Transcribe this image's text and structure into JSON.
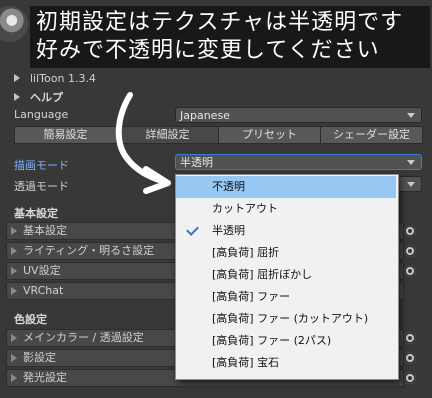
{
  "caption": {
    "line1": "初期設定はテクスチャは半透明です",
    "line2": "好みで不透明に変更してください"
  },
  "header": {
    "version": "lilToon 1.3.4",
    "help": "ヘルプ"
  },
  "language": {
    "label": "Language",
    "value": "Japanese"
  },
  "tabs": [
    {
      "label": "簡易設定"
    },
    {
      "label": "詳細設定"
    },
    {
      "label": "プリセット"
    },
    {
      "label": "シェーダー設定"
    }
  ],
  "render_mode": {
    "label": "描画モード",
    "value": "半透明"
  },
  "transparent_mode": {
    "label": "透過モード"
  },
  "basic": {
    "title": "基本設定",
    "items": [
      {
        "label": "基本設定"
      },
      {
        "label": "ライティング・明るさ設定"
      },
      {
        "label": "UV設定"
      },
      {
        "label": "VRChat"
      }
    ]
  },
  "color": {
    "title": "色設定",
    "items": [
      {
        "label": "メインカラー / 透過設定"
      },
      {
        "label": "影設定"
      },
      {
        "label": "発光設定"
      }
    ]
  },
  "menu": {
    "items": [
      {
        "label": "不透明"
      },
      {
        "label": "カットアウト"
      },
      {
        "label": "半透明"
      },
      {
        "label": "[高負荷] 屈折"
      },
      {
        "label": "[高負荷] 屈折ぼかし"
      },
      {
        "label": "[高負荷] ファー"
      },
      {
        "label": "[高負荷] ファー (カットアウト)"
      },
      {
        "label": "[高負荷] ファー (2パス)"
      },
      {
        "label": "[高負荷] 宝石"
      }
    ],
    "highlighted_index": 0,
    "checked_index": 2
  },
  "colors": {
    "background": "#383838",
    "menu_highlight": "#97c8f4",
    "check": "#3573c7",
    "caption_bg": "#161616"
  }
}
